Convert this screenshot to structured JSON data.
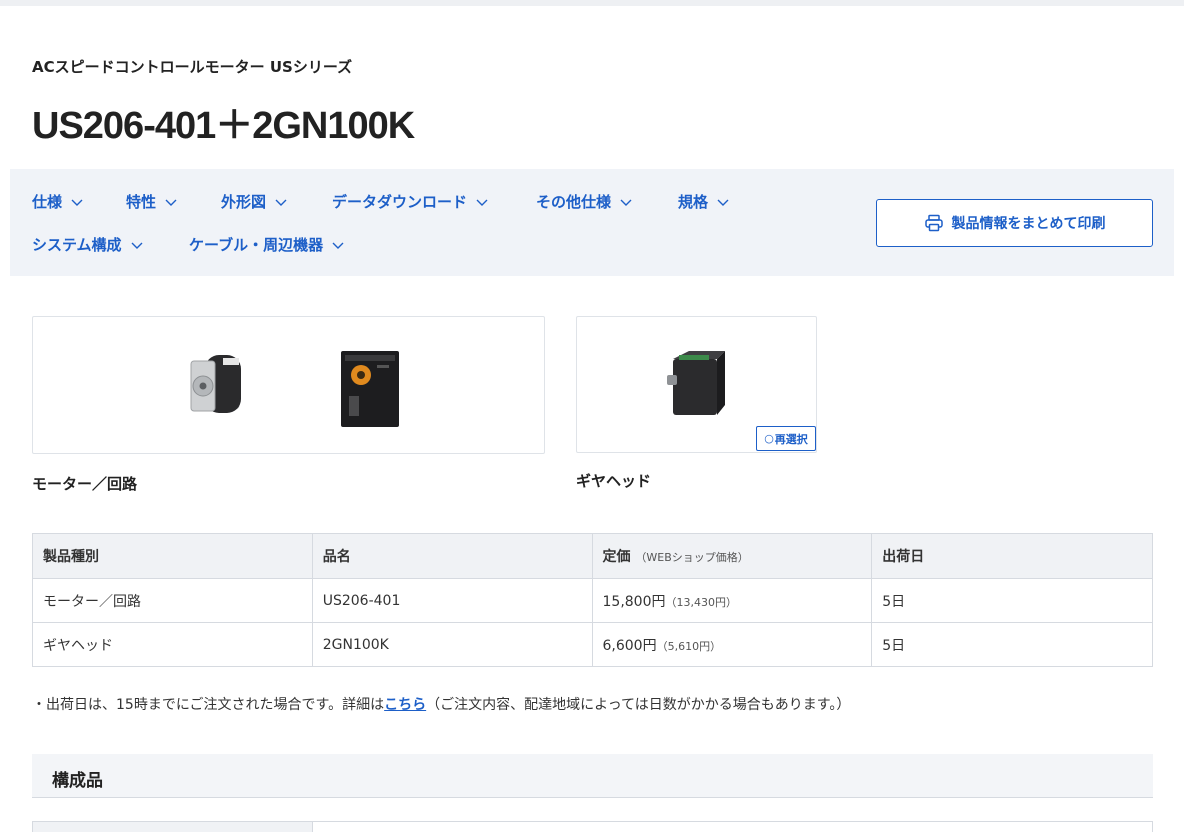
{
  "header": {
    "series": "ACスピードコントロールモーター USシリーズ",
    "product": "US206-401＋2GN100K"
  },
  "nav": {
    "items": [
      {
        "label": "仕様"
      },
      {
        "label": "特性"
      },
      {
        "label": "外形図"
      },
      {
        "label": "データダウンロード"
      },
      {
        "label": "その他仕様"
      },
      {
        "label": "規格"
      },
      {
        "label": "システム構成"
      },
      {
        "label": "ケーブル・周辺機器"
      }
    ],
    "print_label": "製品情報をまとめて印刷"
  },
  "images": {
    "motor_caption": "モーター／回路",
    "gear_caption": "ギヤヘッド",
    "reselect_label": "再選択"
  },
  "table": {
    "headers": [
      "製品種別",
      "品名",
      "定価",
      "（WEBショップ価格）",
      "出荷日"
    ],
    "rows": [
      {
        "type": "モーター／回路",
        "name": "US206-401",
        "price": "15,800円",
        "web_price": "（13,430円）",
        "ship": "5日"
      },
      {
        "type": "ギヤヘッド",
        "name": "2GN100K",
        "price": "6,600円",
        "web_price": "（5,610円）",
        "ship": "5日"
      }
    ]
  },
  "note": {
    "before": "・出荷日は、15時までにご注文された場合です。詳細は",
    "link": "こちら",
    "after": "（ご注文内容、配達地域によっては日数がかかる場合もあります。）"
  },
  "section": {
    "title": "構成品"
  },
  "colors": {
    "accent": "#1d5fc8",
    "nav_bg": "#f0f3f8",
    "table_header_bg": "#f0f2f5",
    "border": "#d6dae0"
  }
}
